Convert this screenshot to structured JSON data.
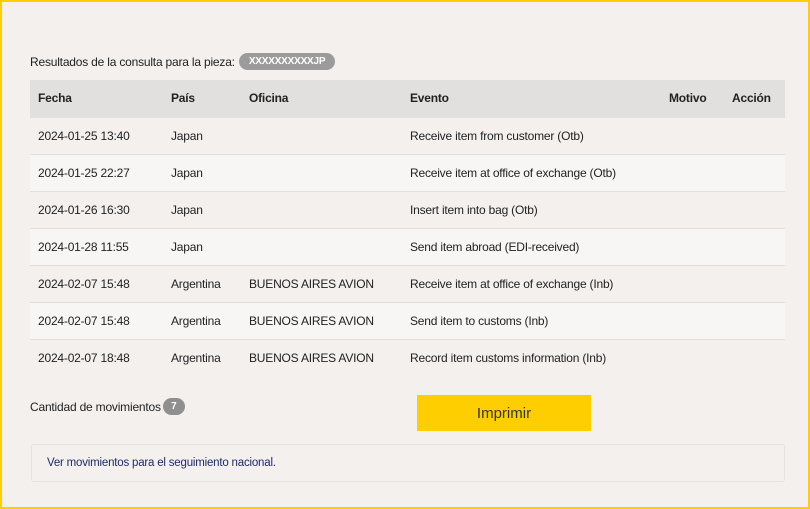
{
  "query": {
    "label": "Resultados de la consulta para la pieza:",
    "piece_id": "XXXXXXXXXXJP"
  },
  "table": {
    "headers": {
      "fecha": "Fecha",
      "pais": "País",
      "oficina": "Oficina",
      "evento": "Evento",
      "motivo": "Motivo",
      "accion": "Acción"
    },
    "rows": [
      {
        "fecha": "2024-01-25 13:40",
        "pais": "Japan",
        "oficina": "",
        "evento": "Receive item from customer (Otb)",
        "motivo": "",
        "accion": ""
      },
      {
        "fecha": "2024-01-25 22:27",
        "pais": "Japan",
        "oficina": "",
        "evento": "Receive item at office of exchange (Otb)",
        "motivo": "",
        "accion": ""
      },
      {
        "fecha": "2024-01-26 16:30",
        "pais": "Japan",
        "oficina": "",
        "evento": "Insert item into bag (Otb)",
        "motivo": "",
        "accion": ""
      },
      {
        "fecha": "2024-01-28 11:55",
        "pais": "Japan",
        "oficina": "",
        "evento": "Send item abroad (EDI-received)",
        "motivo": "",
        "accion": ""
      },
      {
        "fecha": "2024-02-07 15:48",
        "pais": "Argentina",
        "oficina": "BUENOS AIRES AVION",
        "evento": "Receive item at office of exchange (Inb)",
        "motivo": "",
        "accion": ""
      },
      {
        "fecha": "2024-02-07 15:48",
        "pais": "Argentina",
        "oficina": "BUENOS AIRES AVION",
        "evento": "Send item to customs (Inb)",
        "motivo": "",
        "accion": ""
      },
      {
        "fecha": "2024-02-07 18:48",
        "pais": "Argentina",
        "oficina": "BUENOS AIRES AVION",
        "evento": "Record item customs information (Inb)",
        "motivo": "",
        "accion": ""
      }
    ]
  },
  "summary": {
    "count_label": "Cantidad de movimientos",
    "count": "7"
  },
  "actions": {
    "print_label": "Imprimir"
  },
  "national": {
    "link_label": "Ver movimientos para el seguimiento nacional."
  },
  "colors": {
    "accent": "#ffce00",
    "background": "#f3f0ee",
    "header_bg": "#e2e0df",
    "badge_bg": "#9b9b9b",
    "link": "#1f2a66"
  }
}
